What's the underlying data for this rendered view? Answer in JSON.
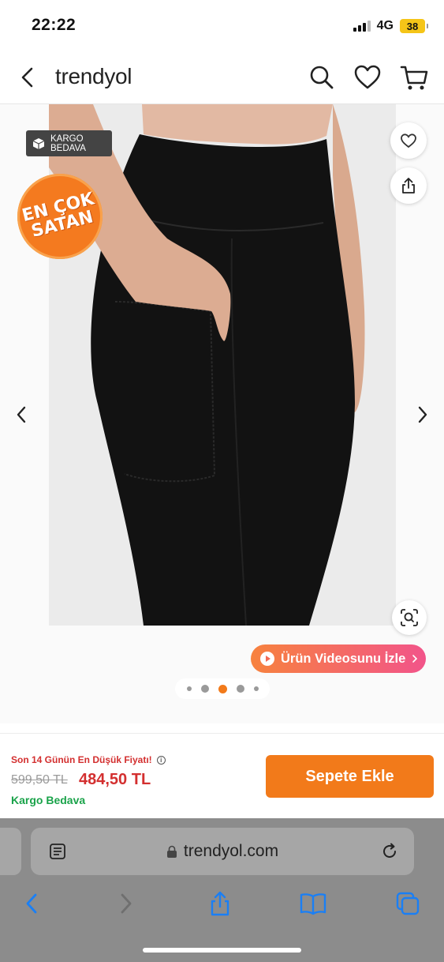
{
  "status": {
    "time": "22:22",
    "network": "4G",
    "battery": "38"
  },
  "header": {
    "logo": "trendyol",
    "icons": [
      "back-icon",
      "search-icon",
      "heart-icon",
      "cart-icon"
    ]
  },
  "gallery": {
    "kargo_badge": [
      "KARGO",
      "BEDAVA"
    ],
    "best_seller_badge": [
      "EN ÇOK",
      "SATAN"
    ],
    "video_button": "Ürün Videosunu İzle",
    "dots_count": 5,
    "active_dot": 2
  },
  "price": {
    "lowest_label": "Son 14 Günün En Düşük Fiyatı!",
    "old_price": "599,50 TL",
    "new_price": "484,50 TL",
    "shipping": "Kargo Bedava",
    "add_to_cart": "Sepete Ekle"
  },
  "browser": {
    "url": "trendyol.com"
  },
  "colors": {
    "brand_orange": "#f27a1a",
    "price_red": "#d32f2f",
    "shipping_green": "#1aa34a"
  }
}
